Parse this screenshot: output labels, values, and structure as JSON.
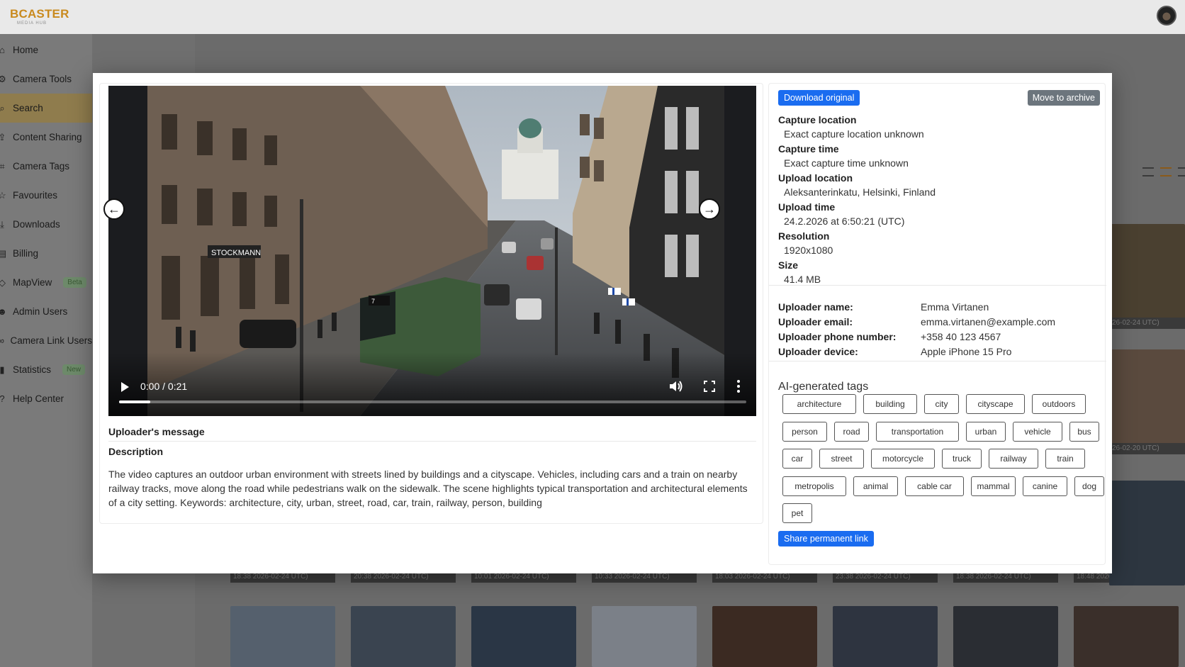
{
  "app": {
    "logo": "BCASTER",
    "logo_sub": "MEDIA HUB"
  },
  "sidebar": {
    "items": [
      {
        "label": "Home",
        "icon": "home-icon"
      },
      {
        "label": "Camera Tools",
        "icon": "gear-icon"
      },
      {
        "label": "Search",
        "icon": "search-icon",
        "active": true
      },
      {
        "label": "Content Sharing",
        "icon": "share-icon"
      },
      {
        "label": "Camera Tags",
        "icon": "tag-icon"
      },
      {
        "label": "Favourites",
        "icon": "star-icon"
      },
      {
        "label": "Downloads",
        "icon": "download-icon"
      },
      {
        "label": "Billing",
        "icon": "billing-icon"
      },
      {
        "label": "MapView",
        "icon": "map-icon",
        "badge": "Beta"
      },
      {
        "label": "Admin Users",
        "icon": "users-icon"
      },
      {
        "label": "Camera Link Users",
        "icon": "link-icon"
      },
      {
        "label": "Statistics",
        "icon": "chart-icon",
        "badge": "New"
      },
      {
        "label": "Help Center",
        "icon": "help-icon"
      }
    ]
  },
  "background_thumbs": {
    "captions": [
      "18:38 2026-02-24 UTC)",
      "20:38 2026-02-24 UTC)",
      "10:01 2026-02-24 UTC)",
      "10:33 2026-02-24 UTC)",
      "18:03 2026-02-24 UTC)",
      "23:38 2026-02-24 UTC)",
      "18:38 2026-02-24 UTC)",
      "18:48 2026-02-24 UTC)"
    ],
    "side_captions": [
      "26-02-24 UTC)",
      "26-02-20 UTC)"
    ]
  },
  "modal": {
    "video": {
      "time": "0:00 / 0:21",
      "progress": 0.05
    },
    "uploader_message_title": "Uploader's message",
    "description_title": "Description",
    "description": "The video captures an outdoor urban environment with streets lined by buildings and a cityscape. Vehicles, including cars and a train on nearby railway tracks, move along the road while pedestrians walk on the sidewalk. The scene highlights typical transportation and architectural elements of a city setting. Keywords: architecture, city, urban, street, road, car, train, railway, person, building",
    "download_label": "Download original",
    "archive_label": "Move to archive",
    "meta": [
      {
        "label": "Capture location",
        "value": "Exact capture location unknown"
      },
      {
        "label": "Capture time",
        "value": "Exact capture time unknown"
      },
      {
        "label": "Upload location",
        "value": "Aleksanterinkatu, Helsinki, Finland"
      },
      {
        "label": "Upload time",
        "value": "24.2.2026 at 6:50:21 (UTC)"
      },
      {
        "label": "Resolution",
        "value": "1920x1080"
      },
      {
        "label": "Size",
        "value": "41.4 MB"
      }
    ],
    "uploader": [
      {
        "label": "Uploader name:",
        "value": "Emma Virtanen"
      },
      {
        "label": "Uploader email:",
        "value": "emma.virtanen@example.com"
      },
      {
        "label": "Uploader phone number:",
        "value": "+358 40 123 4567"
      },
      {
        "label": "Uploader device:",
        "value": "Apple iPhone 15 Pro"
      }
    ],
    "tags_title": "AI-generated tags",
    "tags": [
      [
        "architecture",
        "building",
        "city",
        "cityscape",
        "outdoors"
      ],
      [
        "person",
        "road",
        "transportation",
        "urban",
        "vehicle",
        "bus"
      ],
      [
        "car",
        "street",
        "motorcycle",
        "truck",
        "railway",
        "train"
      ],
      [
        "metropolis",
        "animal",
        "cable car",
        "mammal",
        "canine",
        "dog"
      ],
      [
        "pet"
      ]
    ],
    "share_label": "Share permanent link"
  }
}
